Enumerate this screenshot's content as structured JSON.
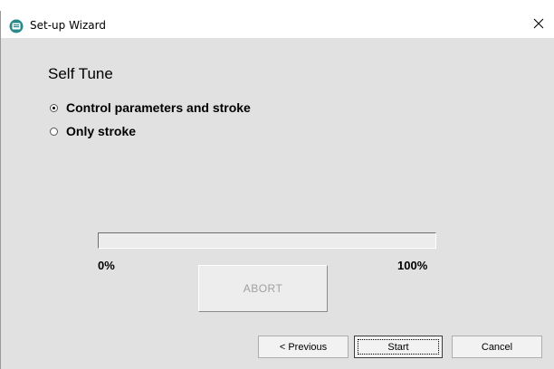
{
  "window": {
    "title": "Set-up Wizard",
    "app_icon": "app-icon",
    "close_icon": "close-icon"
  },
  "page": {
    "heading": "Self Tune",
    "options": [
      {
        "label": "Control parameters and stroke",
        "selected": true
      },
      {
        "label": "Only stroke",
        "selected": false
      }
    ]
  },
  "progress": {
    "value_percent": 0,
    "min_label": "0%",
    "max_label": "100%"
  },
  "abort_button": {
    "label": "ABORT",
    "enabled": false
  },
  "footer": {
    "previous_label": "< Previous",
    "start_label": "Start",
    "cancel_label": "Cancel"
  },
  "colors": {
    "client_background": "#e1e1e1",
    "titlebar_background": "#ffffff",
    "disabled_text": "#a0a0a0",
    "app_icon_accent": "#2a8a8a"
  }
}
